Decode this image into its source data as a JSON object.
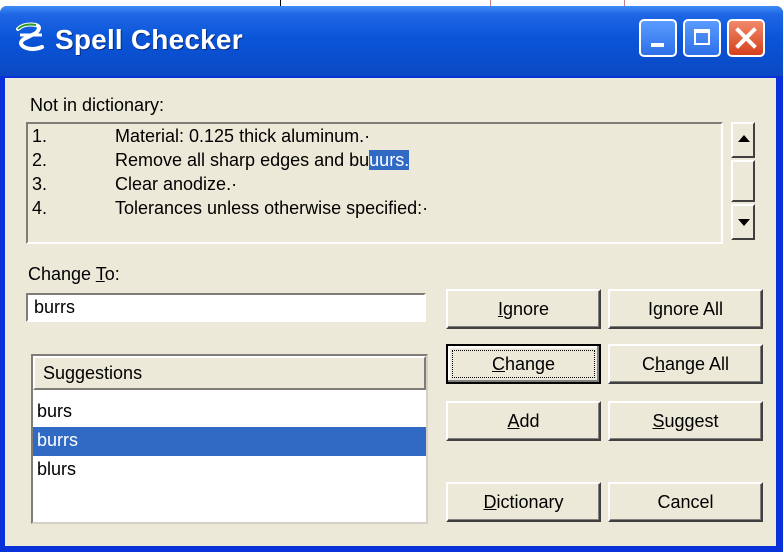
{
  "window": {
    "title": "Spell Checker",
    "app_icon": "microstation-logo-icon",
    "controls": [
      "minimize-icon",
      "maximize-icon",
      "close-icon"
    ]
  },
  "not_in_dictionary": {
    "label": "Not in dictionary:",
    "lines": [
      {
        "num": "1.",
        "text": "Material: 0.125 thick aluminum.·"
      },
      {
        "num": "2.",
        "text_before": "Remove all sharp edges and bu",
        "text_highlight": "uurs."
      },
      {
        "num": "3.",
        "text": "Clear anodize.·"
      },
      {
        "num": "4.",
        "text": "Tolerances unless otherwise specified:·"
      }
    ]
  },
  "change_to": {
    "label_pre": "Change ",
    "label_key": "T",
    "label_post": "o:",
    "value": "burrs"
  },
  "suggestions": {
    "header": "Suggestions",
    "items": [
      "burs",
      "burrs",
      "blurs"
    ],
    "selected": "burrs"
  },
  "buttons": {
    "ignore": {
      "key": "I",
      "rest": "gnore"
    },
    "ignore_all": {
      "pre": "I",
      "key": "g",
      "rest": "nore All"
    },
    "change": {
      "pre": "",
      "key": "C",
      "rest": "hange"
    },
    "change_all": {
      "pre": "C",
      "key": "h",
      "rest": "ange All"
    },
    "add": {
      "key": "A",
      "rest": "dd"
    },
    "suggest": {
      "key": "S",
      "rest": "uggest"
    },
    "dictionary": {
      "key": "D",
      "rest": "ictionary"
    },
    "cancel": {
      "label": "Cancel"
    }
  },
  "colors": {
    "title_bar": "#0a55d8",
    "dialog_face": "#ece9d8",
    "selection": "#316ac5"
  }
}
